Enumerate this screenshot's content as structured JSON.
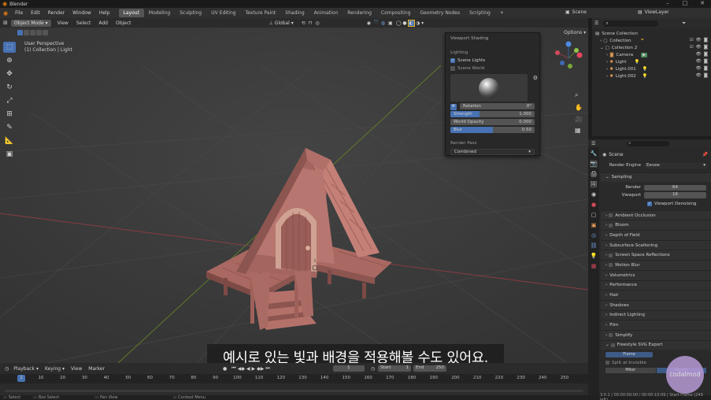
{
  "app": {
    "title": "Blender"
  },
  "window_controls": [
    "–",
    "□",
    "✕"
  ],
  "menu": [
    "File",
    "Edit",
    "Render",
    "Window",
    "Help"
  ],
  "workspaces": [
    "Layout",
    "Modeling",
    "Sculpting",
    "UV Editing",
    "Texture Paint",
    "Shading",
    "Animation",
    "Rendering",
    "Compositing",
    "Geometry Nodes",
    "Scripting"
  ],
  "scene_name": "Scene",
  "view_layer": "ViewLayer",
  "viewport_header": {
    "mode": "Object Mode",
    "menus": [
      "View",
      "Select",
      "Add",
      "Object"
    ],
    "transform": "Global",
    "options": "Options"
  },
  "viewport_info": {
    "line1": "User Perspective",
    "line2": "(1) Collection | Light"
  },
  "shading_popover": {
    "header": "Viewport Shading",
    "lighting_label": "Lighting",
    "scene_lights": "Scene Lights",
    "scene_lights_checked": true,
    "scene_world": "Scene World",
    "scene_world_checked": false,
    "rotation": {
      "label": "Rotation",
      "value": "0°"
    },
    "strength": {
      "label": "Strength",
      "value": "1.000",
      "fill": 0.35
    },
    "world_opacity": {
      "label": "World Opacity",
      "value": "0.000",
      "fill": 0.0
    },
    "blur": {
      "label": "Blur",
      "value": "0.50",
      "fill": 0.5
    },
    "render_pass_label": "Render Pass",
    "render_pass_value": "Combined"
  },
  "outliner": {
    "rows": [
      {
        "label": "Scene Collection",
        "indent": 0
      },
      {
        "label": "Collection",
        "indent": 1
      },
      {
        "label": "Collection 2",
        "indent": 1
      },
      {
        "label": "Camera",
        "indent": 2
      },
      {
        "label": "Light",
        "indent": 2
      },
      {
        "label": "Light.001",
        "indent": 2
      },
      {
        "label": "Light.002",
        "indent": 2
      }
    ]
  },
  "properties": {
    "scene_label": "Scene",
    "render_engine_label": "Render Engine",
    "render_engine_value": "Eevee",
    "sampling": "Sampling",
    "render_label": "Render",
    "render_value": "64",
    "viewport_label": "Viewport",
    "viewport_value": "16",
    "denoising": "Viewport Denoising",
    "panels": [
      "Ambient Occlusion",
      "Bloom",
      "Depth of Field",
      "Subsurface Scattering",
      "Screen Space Reflections",
      "Motion Blur",
      "Volumetrics",
      "Performance",
      "Hair",
      "Shadows",
      "Indirect Lighting",
      "Film",
      "Simplify",
      "Freestyle SVG Export"
    ],
    "freestyle_frame": "Frame",
    "freestyle_split": "Split at Invisible",
    "freestyle_miter": "Miter",
    "freestyle_round": "Round"
  },
  "timeline": {
    "menus": [
      "Playback",
      "Keying",
      "View",
      "Marker"
    ],
    "current_frame": "1",
    "start_label": "Start",
    "start": "1",
    "end_label": "End",
    "end": "250",
    "ticks": [
      "1",
      "10",
      "20",
      "30",
      "40",
      "50",
      "60",
      "70",
      "80",
      "90",
      "100",
      "110",
      "120",
      "130",
      "140",
      "150",
      "160",
      "170",
      "180",
      "190",
      "200",
      "210",
      "220",
      "230",
      "240",
      "250"
    ]
  },
  "statusbar": {
    "select": "Select",
    "box_select": "Box Select",
    "pan_view": "Pan View",
    "context_menu": "Context Menu",
    "version": "3.0.1 | 00:00:00:00 / 00:00:10:09 | Start Frame (249 left)"
  },
  "subtitle": "예시로 있는 빛과 배경을 적용해볼 수도 있어요.",
  "watermark": "codalmod",
  "colors": {
    "accent": "#4772b3",
    "house": "#b9736a",
    "viewport_bg": "#3a3a3a",
    "highlight": "#e6b422"
  }
}
